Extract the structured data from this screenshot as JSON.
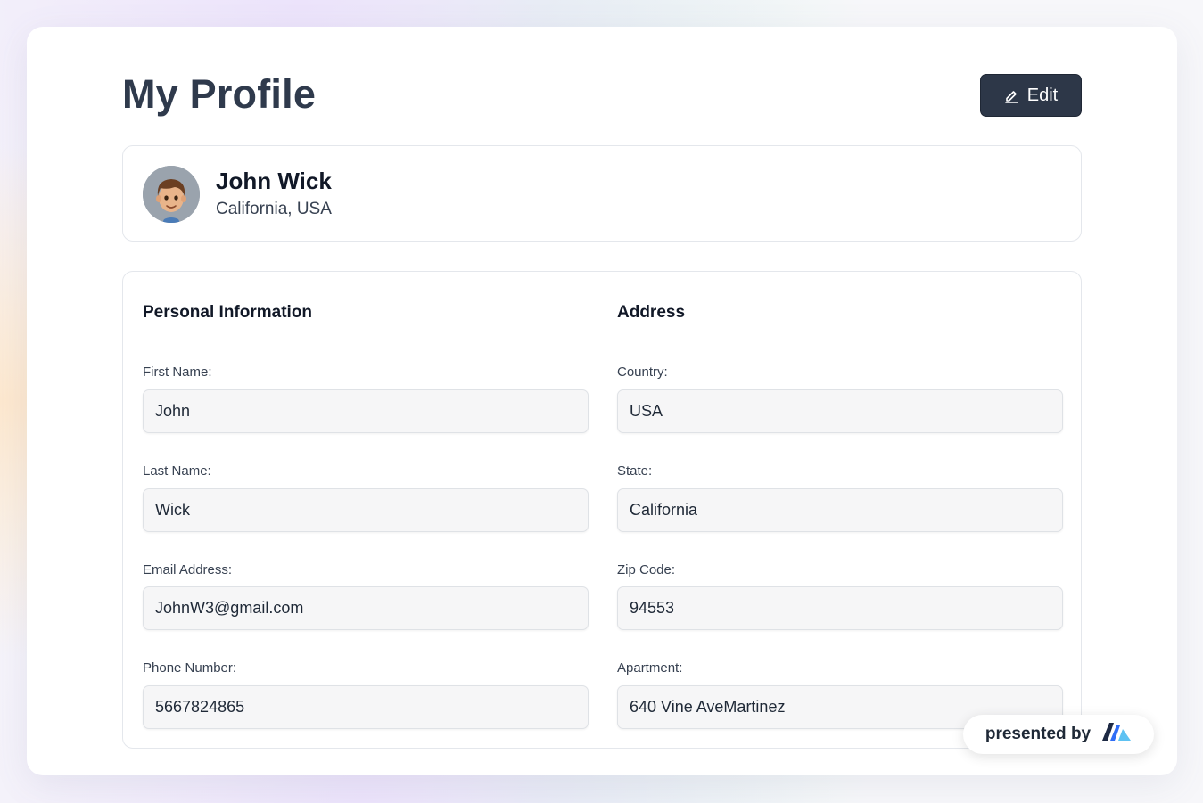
{
  "header": {
    "title": "My Profile",
    "edit_label": "Edit",
    "edit_icon": "pencil-icon"
  },
  "profile": {
    "name": "John Wick",
    "location": "California, USA",
    "avatar_icon": "avatar-emoji-boy"
  },
  "personal": {
    "heading": "Personal Information",
    "fields": [
      {
        "label": "First Name:",
        "value": "John"
      },
      {
        "label": "Last Name:",
        "value": "Wick"
      },
      {
        "label": "Email Address:",
        "value": "JohnW3@gmail.com"
      },
      {
        "label": "Phone Number:",
        "value": "5667824865"
      }
    ]
  },
  "address": {
    "heading": "Address",
    "fields": [
      {
        "label": "Country:",
        "value": "USA"
      },
      {
        "label": "State:",
        "value": "California"
      },
      {
        "label": "Zip Code:",
        "value": "94553"
      },
      {
        "label": "Apartment:",
        "value": "640 Vine AveMartinez"
      }
    ]
  },
  "badge": {
    "label": "presented by",
    "logo_icon": "brand-logo-icon"
  },
  "colors": {
    "button_bg": "#2d3748",
    "title_text": "#2f3a4c",
    "logo_dark": "#1e2a44",
    "logo_blue": "#2f6df6",
    "logo_cyan": "#5ec2f2"
  }
}
